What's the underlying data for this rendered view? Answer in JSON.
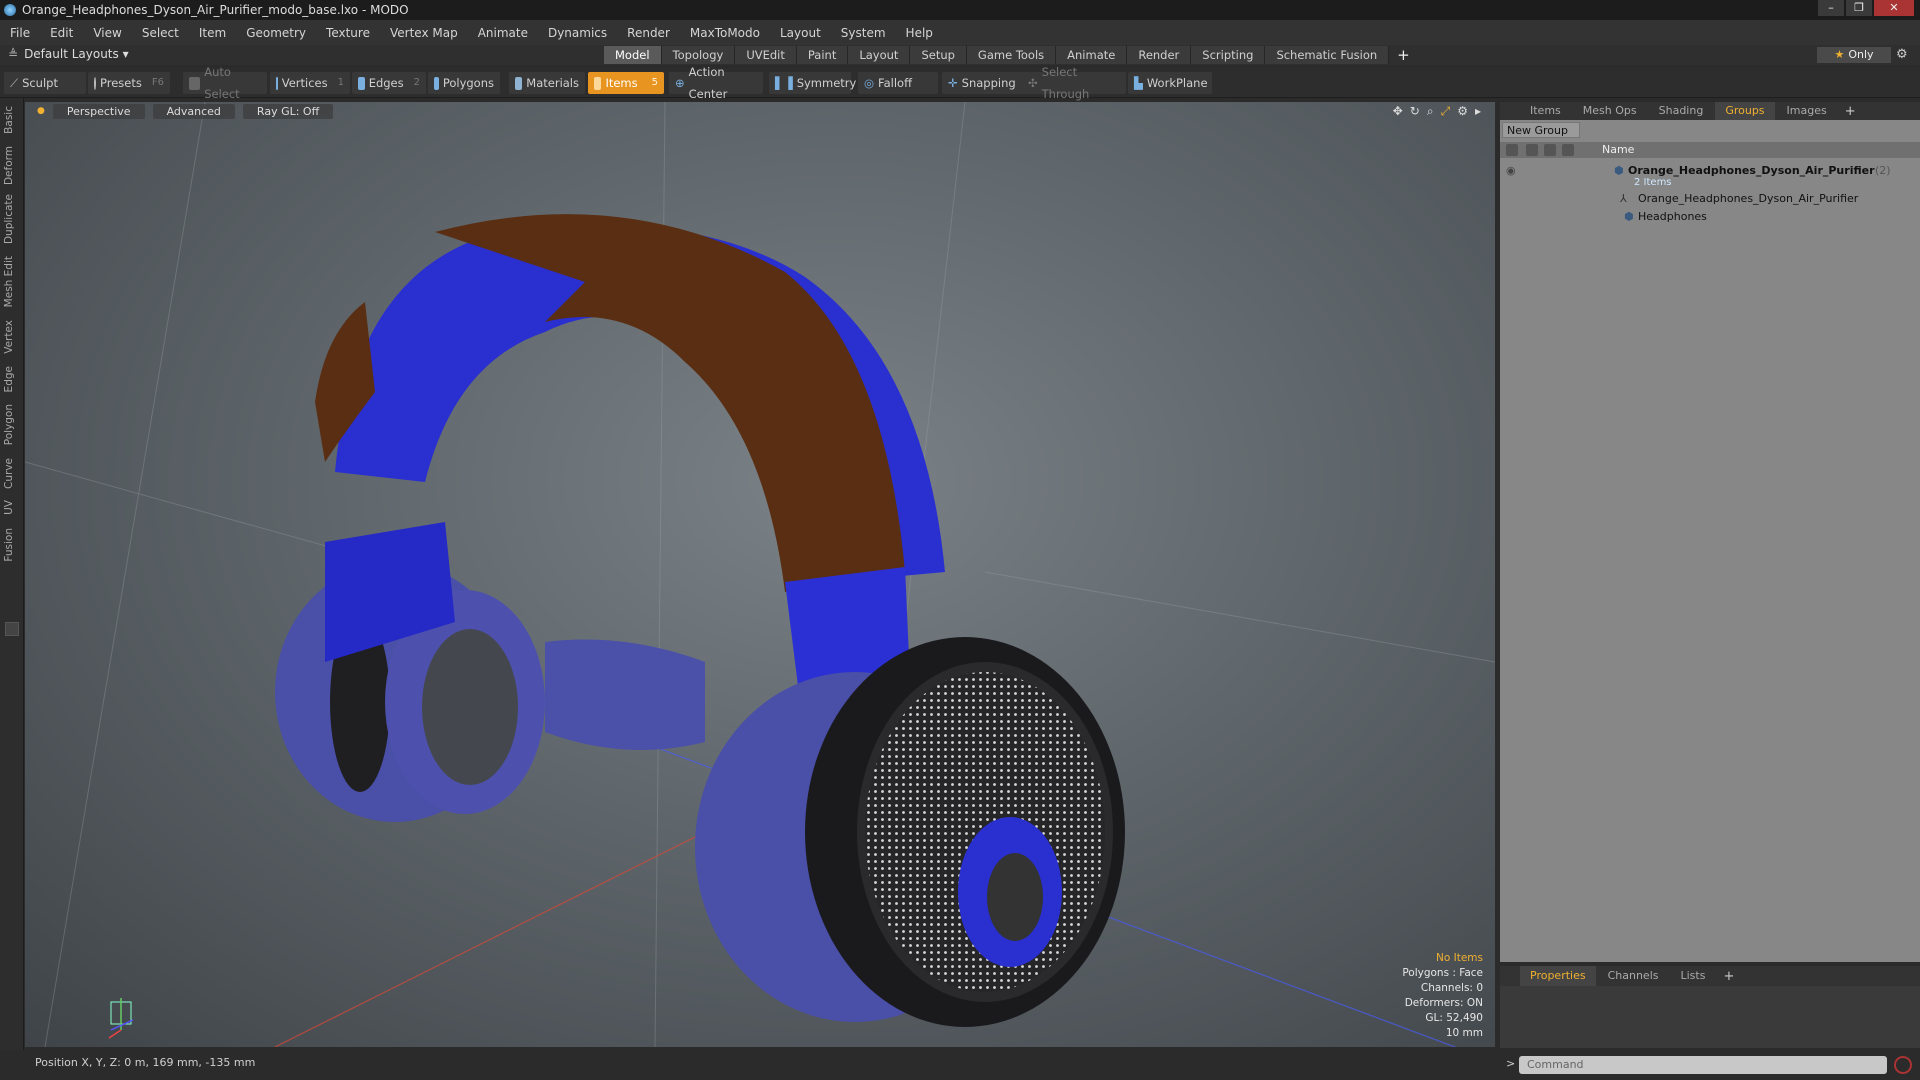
{
  "window": {
    "title": "Orange_Headphones_Dyson_Air_Purifier_modo_base.lxo - MODO",
    "controls": [
      "–",
      "❐",
      "✕"
    ]
  },
  "menu": [
    "File",
    "Edit",
    "View",
    "Select",
    "Item",
    "Geometry",
    "Texture",
    "Vertex Map",
    "Animate",
    "Dynamics",
    "Render",
    "MaxToModo",
    "Layout",
    "System",
    "Help"
  ],
  "layouts": {
    "label": "Default Layouts ▾"
  },
  "tabs": [
    "Model",
    "Topology",
    "UVEdit",
    "Paint",
    "Layout",
    "Setup",
    "Game Tools",
    "Animate",
    "Render",
    "Scripting",
    "Schematic Fusion"
  ],
  "tabs_add": "+",
  "only_button": "Only",
  "toolbar": {
    "sculpt": "Sculpt",
    "presets": "Presets",
    "presets_key": "F6",
    "auto_select": "Auto Select",
    "vertices": "Vertices",
    "vertices_count": "1",
    "edges": "Edges",
    "edges_count": "2",
    "polygons": "Polygons",
    "materials": "Materials",
    "items": "Items",
    "items_count": "5",
    "action_center": "Action Center",
    "symmetry": "Symmetry",
    "falloff": "Falloff",
    "snapping": "Snapping",
    "select_through": "Select Through",
    "workplane": "WorkPlane"
  },
  "left_tabs": [
    "Basic",
    "Deform",
    "Duplicate",
    "Mesh Edit",
    "Vertex",
    "Edge",
    "Polygon",
    "Curve",
    "UV",
    "Fusion"
  ],
  "viewport": {
    "view_mode": "Perspective",
    "shading": "Advanced",
    "raygl": "Ray GL: Off",
    "info": [
      "No Items",
      "Polygons : Face",
      "Channels: 0",
      "Deformers: ON",
      "GL: 52,490",
      "10 mm"
    ]
  },
  "status": {
    "position": "Position X, Y, Z:  0 m, 169 mm, -135 mm"
  },
  "right_panel": {
    "tabs": [
      "Items",
      "Mesh Ops",
      "Shading",
      "Groups",
      "Images"
    ],
    "active_tab": "Groups",
    "new_group": "New Group",
    "column_name": "Name",
    "rows": [
      {
        "label": "Orange_Headphones_Dyson_Air_Purifier",
        "suffix": "(2)",
        "sub": "2 Items"
      },
      {
        "label": "Orange_Headphones_Dyson_Air_Purifier"
      },
      {
        "label": "Headphones"
      }
    ]
  },
  "properties_panel": {
    "tabs": [
      "Properties",
      "Channels",
      "Lists"
    ],
    "active_tab": "Properties"
  },
  "command": {
    "placeholder": "Command"
  },
  "colors": {
    "accent_orange": "#e89420",
    "mesh_blue": "#2a2fd0",
    "mesh_brown": "#5a2e12"
  }
}
